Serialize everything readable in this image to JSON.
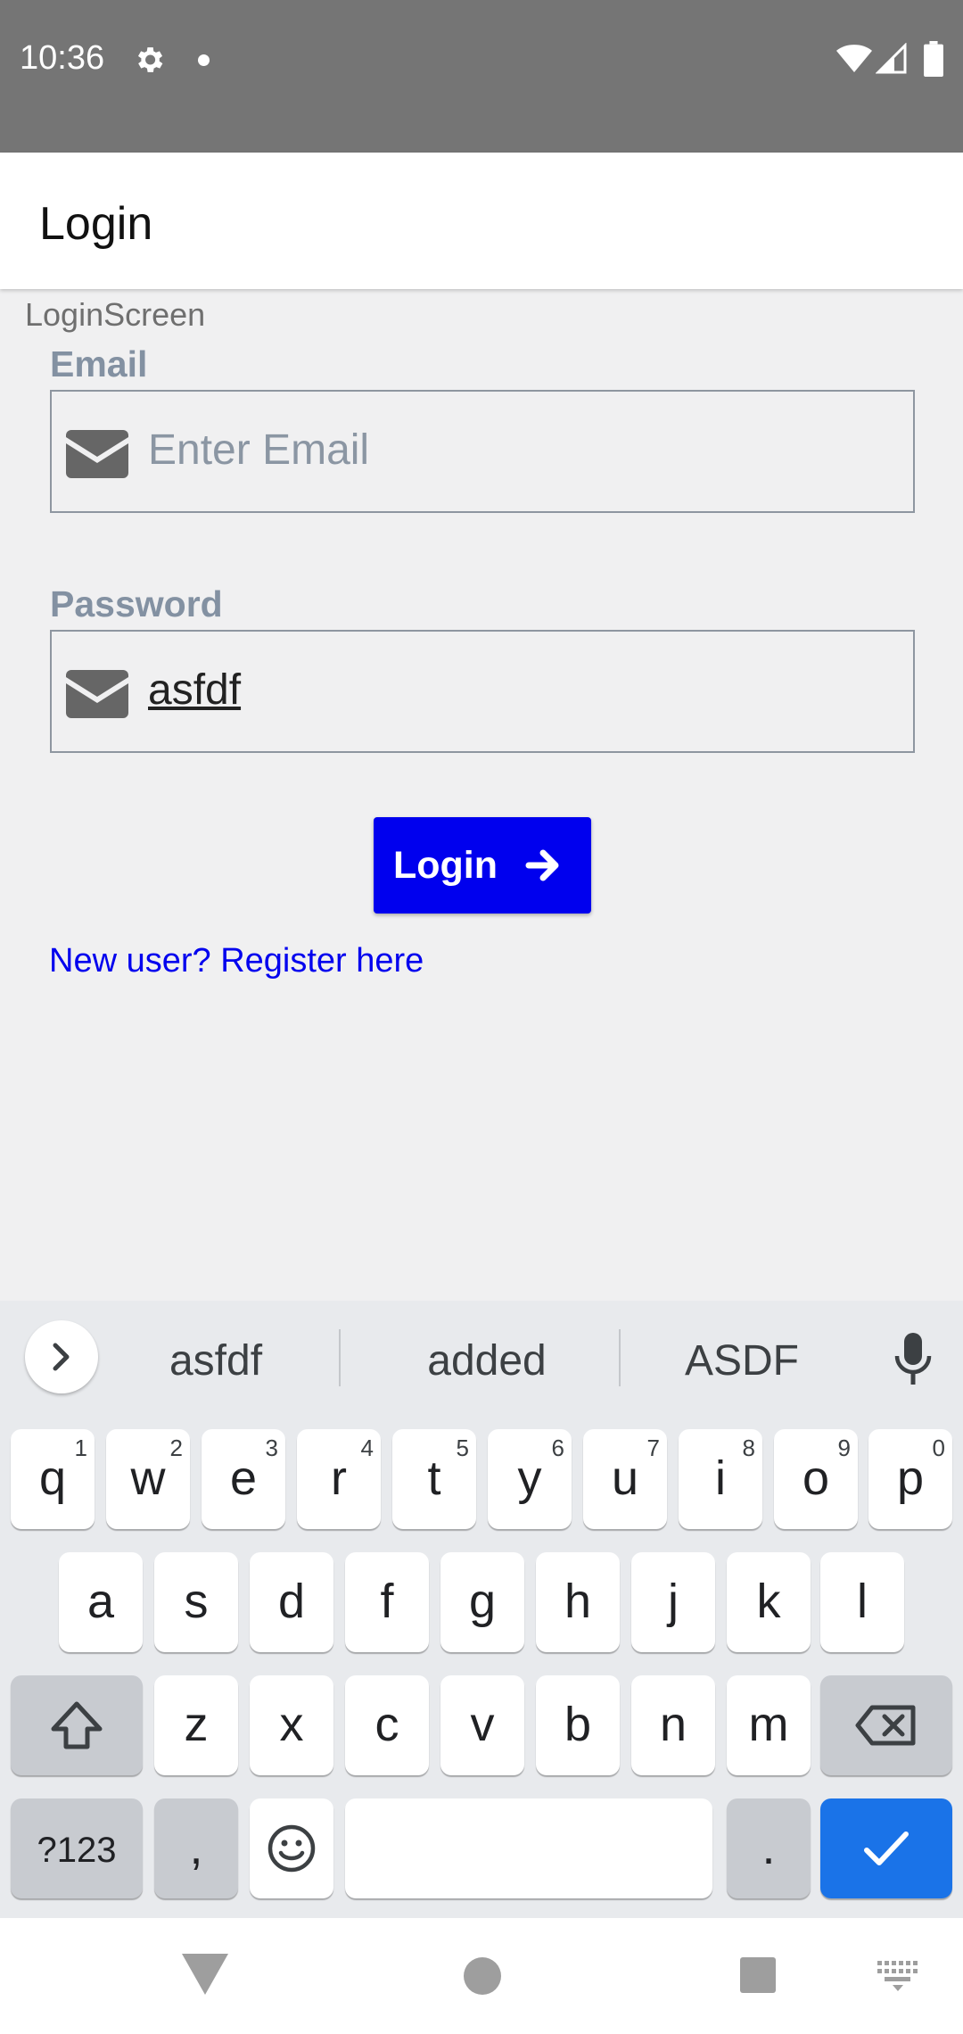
{
  "status_bar": {
    "time": "10:36"
  },
  "app_bar": {
    "title": "Login"
  },
  "screen_label": "LoginScreen",
  "email": {
    "label": "Email",
    "placeholder": "Enter Email",
    "value": ""
  },
  "password": {
    "label": "Password",
    "value": "asfdf"
  },
  "login_button": {
    "label": "Login"
  },
  "register_link": "New user? Register here",
  "keyboard": {
    "suggestions": [
      "asfdf",
      "added",
      "ASDF"
    ],
    "row1": [
      {
        "char": "q",
        "hint": "1"
      },
      {
        "char": "w",
        "hint": "2"
      },
      {
        "char": "e",
        "hint": "3"
      },
      {
        "char": "r",
        "hint": "4"
      },
      {
        "char": "t",
        "hint": "5"
      },
      {
        "char": "y",
        "hint": "6"
      },
      {
        "char": "u",
        "hint": "7"
      },
      {
        "char": "i",
        "hint": "8"
      },
      {
        "char": "o",
        "hint": "9"
      },
      {
        "char": "p",
        "hint": "0"
      }
    ],
    "row2": [
      "a",
      "s",
      "d",
      "f",
      "g",
      "h",
      "j",
      "k",
      "l"
    ],
    "row3": [
      "z",
      "x",
      "c",
      "v",
      "b",
      "n",
      "m"
    ],
    "symbols_label": "?123",
    "comma": ",",
    "period": "."
  },
  "colors": {
    "accent": "#0000ee",
    "status_bar": "#757575",
    "enter_key": "#1a73e8",
    "field_label": "#8391a2"
  },
  "icons": {
    "status": [
      "settings-icon",
      "notification-dot-icon",
      "wifi-icon",
      "signal-icon",
      "battery-icon"
    ],
    "fields": [
      "mail-icon"
    ],
    "button": "arrow-right-icon",
    "keyboard": [
      "chevron-right-icon",
      "microphone-icon",
      "shift-icon",
      "backspace-icon",
      "emoji-icon",
      "checkmark-icon"
    ],
    "nav": [
      "back-icon",
      "home-icon",
      "recents-icon",
      "keyboard-switch-icon"
    ]
  }
}
